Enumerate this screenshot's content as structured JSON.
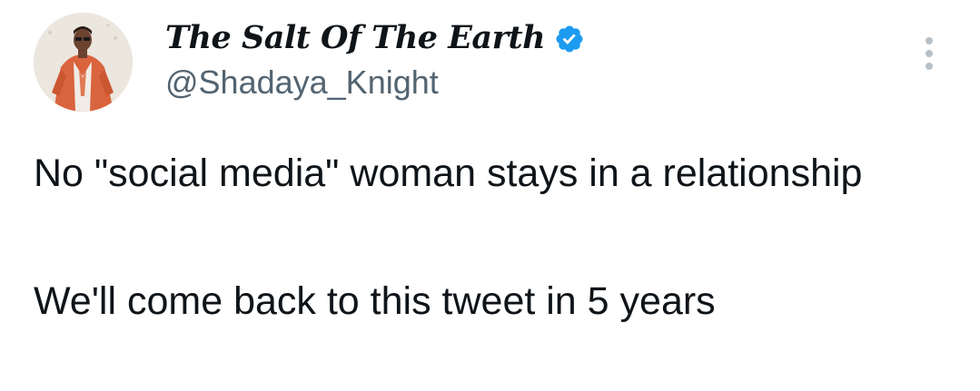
{
  "author": {
    "display_name": "The Salt Of The Earth",
    "handle": "@Shadaya_Knight",
    "verified": true,
    "avatar_icon": "profile-photo-avatar",
    "verified_icon": "verified-badge-icon"
  },
  "tweet": {
    "paragraphs": [
      "No \"social media\" woman stays in a relationship",
      "We'll come back to this tweet in 5 years"
    ]
  },
  "menu": {
    "icon": "more-vertical-icon"
  },
  "colors": {
    "text_primary": "#0f1419",
    "text_secondary": "#536471",
    "verified_blue": "#1d9bf0",
    "background": "#ffffff",
    "menu_dots": "#b8c0c7"
  }
}
